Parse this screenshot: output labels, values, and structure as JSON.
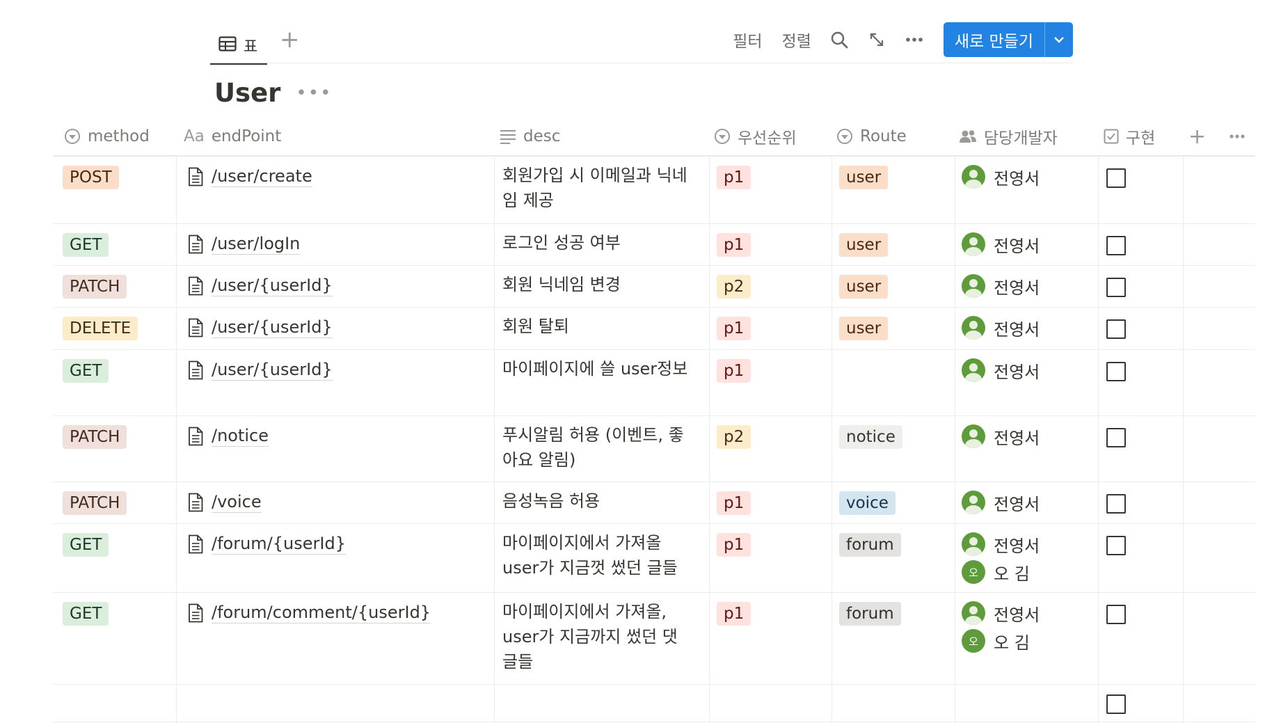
{
  "view_tab": {
    "label": "표",
    "icon": "table-icon"
  },
  "toolbar": {
    "filter": "필터",
    "sort": "정렬",
    "new_label": "새로 만들기"
  },
  "title": "User",
  "columns": {
    "method": "method",
    "endpoint": "endPoint",
    "endpoint_prefix": "Aa",
    "desc": "desc",
    "priority": "우선순위",
    "route": "Route",
    "developer": "담당개발자",
    "implemented": "구현"
  },
  "colors": {
    "accent": "#2383e2",
    "avatar": "#5e9b3a"
  },
  "rows": [
    {
      "method": "POST",
      "endpoint": "/user/create",
      "desc": "회원가입 시 이메일과 닉네임 제공",
      "priority": "p1",
      "route": "user",
      "devs": [
        "전영서"
      ],
      "done": false
    },
    {
      "method": "GET",
      "endpoint": "/user/logIn",
      "desc": "로그인 성공 여부",
      "priority": "p1",
      "route": "user",
      "devs": [
        "전영서"
      ],
      "done": false
    },
    {
      "method": "PATCH",
      "endpoint": "/user/{userId}",
      "desc": "회원 닉네임 변경",
      "priority": "p2",
      "route": "user",
      "devs": [
        "전영서"
      ],
      "done": false
    },
    {
      "method": "DELETE",
      "endpoint": "/user/{userId}",
      "desc": "회원 탈퇴",
      "priority": "p1",
      "route": "user",
      "devs": [
        "전영서"
      ],
      "done": false
    },
    {
      "method": "GET",
      "endpoint": "/user/{userId}",
      "desc": "마이페이지에 쓸 user정보",
      "priority": "p1",
      "route": "",
      "devs": [
        "전영서"
      ],
      "done": false
    },
    {
      "method": "PATCH",
      "endpoint": "/notice",
      "desc": "푸시알림 허용 (이벤트, 좋아요 알림)",
      "priority": "p2",
      "route": "notice",
      "devs": [
        "전영서"
      ],
      "done": false
    },
    {
      "method": "PATCH",
      "endpoint": "/voice",
      "desc": "음성녹음 허용",
      "priority": "p1",
      "route": "voice",
      "devs": [
        "전영서"
      ],
      "done": false
    },
    {
      "method": "GET",
      "endpoint": "/forum/{userId}",
      "desc": "마이페이지에서 가져올 user가 지금껏 썼던 글들",
      "priority": "p1",
      "route": "forum",
      "devs": [
        "전영서",
        "오 김"
      ],
      "done": false
    },
    {
      "method": "GET",
      "endpoint": "/forum/comment/{userId}",
      "desc": "마이페이지에서 가져올, user가 지금까지 썼던 댓글들",
      "priority": "p1",
      "route": "forum",
      "devs": [
        "전영서",
        "오 김"
      ],
      "done": false
    }
  ],
  "avatar_initial_2": "오"
}
